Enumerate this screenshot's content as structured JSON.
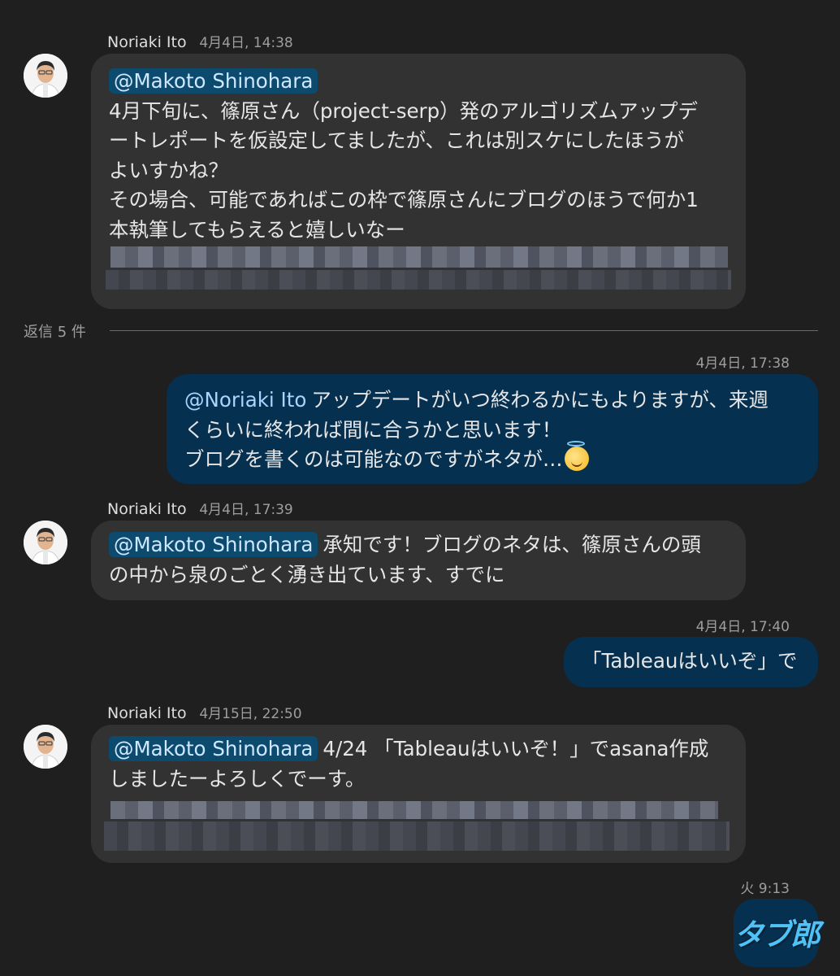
{
  "messages": [
    {
      "sender": "Noriaki Ito",
      "time": "4月4日, 14:38",
      "mention": "@Makoto Shinohara",
      "lines": [
        "4月下旬に、篠原さん（project-serp）発のアルゴリズムアップデ",
        "ートレポートを仮設定してましたが、これは別スケにしたほうが",
        "よいすかね？",
        "その場合、可能であればこの枠で篠原さんにブログのほうで何か1",
        "本執筆してもらえると嬉しいなー"
      ]
    },
    {
      "time": "4月4日, 17:38",
      "mention": "@Noriaki Ito",
      "lines": [
        "アップデートがいつ終わるかにもよりますが、来週",
        "くらいに終われば間に合うかと思います！",
        "ブログを書くのは可能なのですがネタが…"
      ],
      "emoji": "smiling-face-with-halo-emoji"
    },
    {
      "sender": "Noriaki Ito",
      "time": "4月4日, 17:39",
      "mention": "@Makoto Shinohara",
      "lines": [
        "承知です！ブログのネタは、篠原さんの頭",
        "の中から泉のごとく湧き出ています、すでに"
      ]
    },
    {
      "time": "4月4日, 17:40",
      "text": "「Tableauはいいぞ」で"
    },
    {
      "sender": "Noriaki Ito",
      "time": "4月15日, 22:50",
      "mention": "@Makoto Shinohara",
      "lines": [
        "4/24 「Tableauはいいぞ！」でasana作成",
        "しましたーよろしくでーす。"
      ]
    },
    {
      "time": "火 9:13",
      "sticker_text": "タブ郎"
    }
  ],
  "replies_label": "返信 5 件",
  "colors": {
    "background": "#1f1f1f",
    "bubble_other": "#323232",
    "bubble_self": "#063050",
    "mention_chip": "#0c4a6e",
    "mention_link": "#a9d4ff"
  }
}
